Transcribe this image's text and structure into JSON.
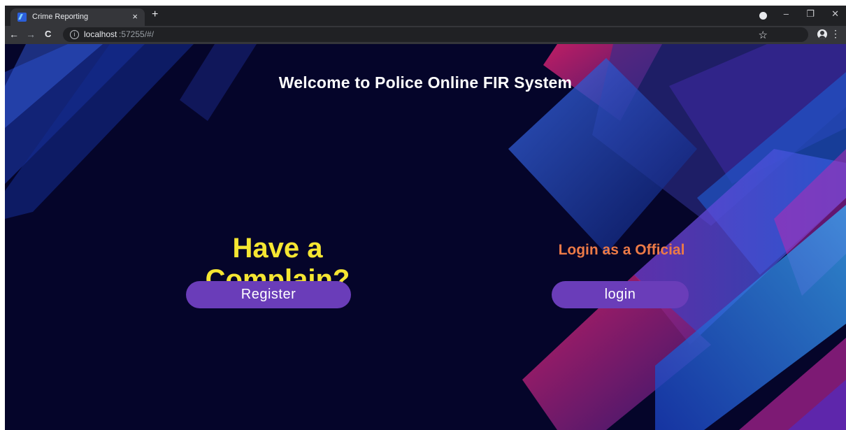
{
  "browser": {
    "tab_title": "Crime Reporting",
    "tab_close": "×",
    "new_tab": "+",
    "window_controls": {
      "minimize": "–",
      "maximize": "❐",
      "close": "✕"
    },
    "nav": {
      "back": "←",
      "forward": "→",
      "reload": "C"
    },
    "info_icon": "i",
    "url_host": "localhost",
    "url_rest": ":57255/#/",
    "star": "☆",
    "menu": "⋮"
  },
  "page": {
    "title": "Welcome to Police Online FIR System",
    "complain_heading": "Have a Complain?",
    "register_label": "Register",
    "official_heading": "Login as a Official",
    "login_label": "login"
  },
  "colors": {
    "background": "#05052a",
    "complain_heading": "#f5e632",
    "official_heading": "#ec7a47",
    "button": "#6a3db9",
    "title": "#ffffff"
  }
}
